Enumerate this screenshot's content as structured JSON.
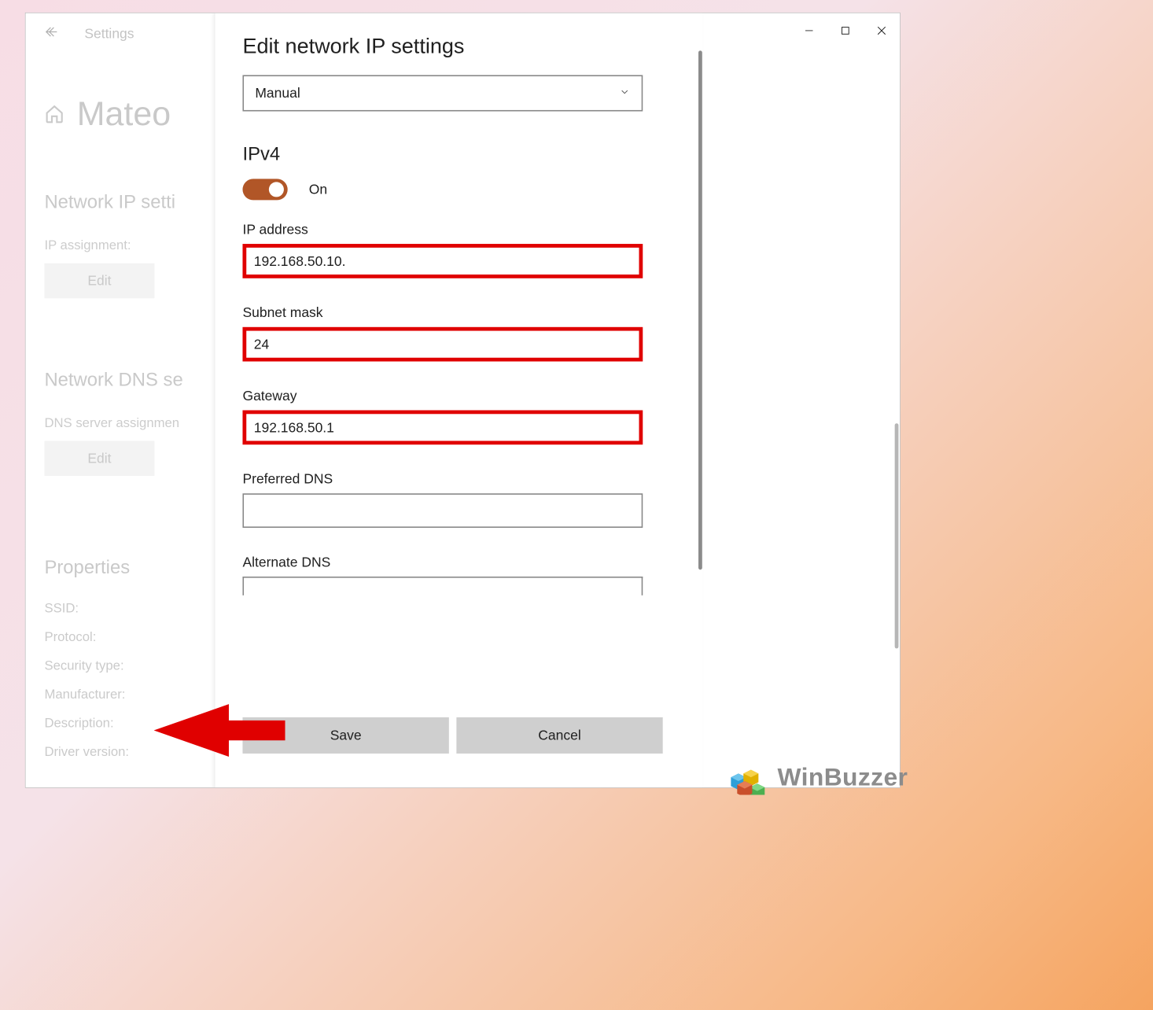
{
  "header": {
    "settings_label": "Settings",
    "page_title": "Mateo"
  },
  "sections": {
    "ip": {
      "title": "Network IP setti",
      "sub": "IP assignment:",
      "edit_label": "Edit"
    },
    "dns": {
      "title": "Network DNS se",
      "sub": "DNS server assignmen",
      "edit_label": "Edit"
    },
    "props": {
      "title": "Properties",
      "rows": [
        "SSID:",
        "Protocol:",
        "Security type:",
        "Manufacturer:",
        "Description:",
        "Driver version:"
      ]
    }
  },
  "modal": {
    "title": "Edit network IP settings",
    "mode": "Manual",
    "ipv4_label": "IPv4",
    "toggle_state": "On",
    "fields": {
      "ip_label": "IP address",
      "ip_value": "192.168.50.10.",
      "mask_label": "Subnet mask",
      "mask_value": "24",
      "gw_label": "Gateway",
      "gw_value": "192.168.50.1",
      "pdns_label": "Preferred DNS",
      "pdns_value": "",
      "adns_label": "Alternate DNS",
      "adns_value": ""
    },
    "save_label": "Save",
    "cancel_label": "Cancel"
  },
  "watermark": "WinBuzzer"
}
